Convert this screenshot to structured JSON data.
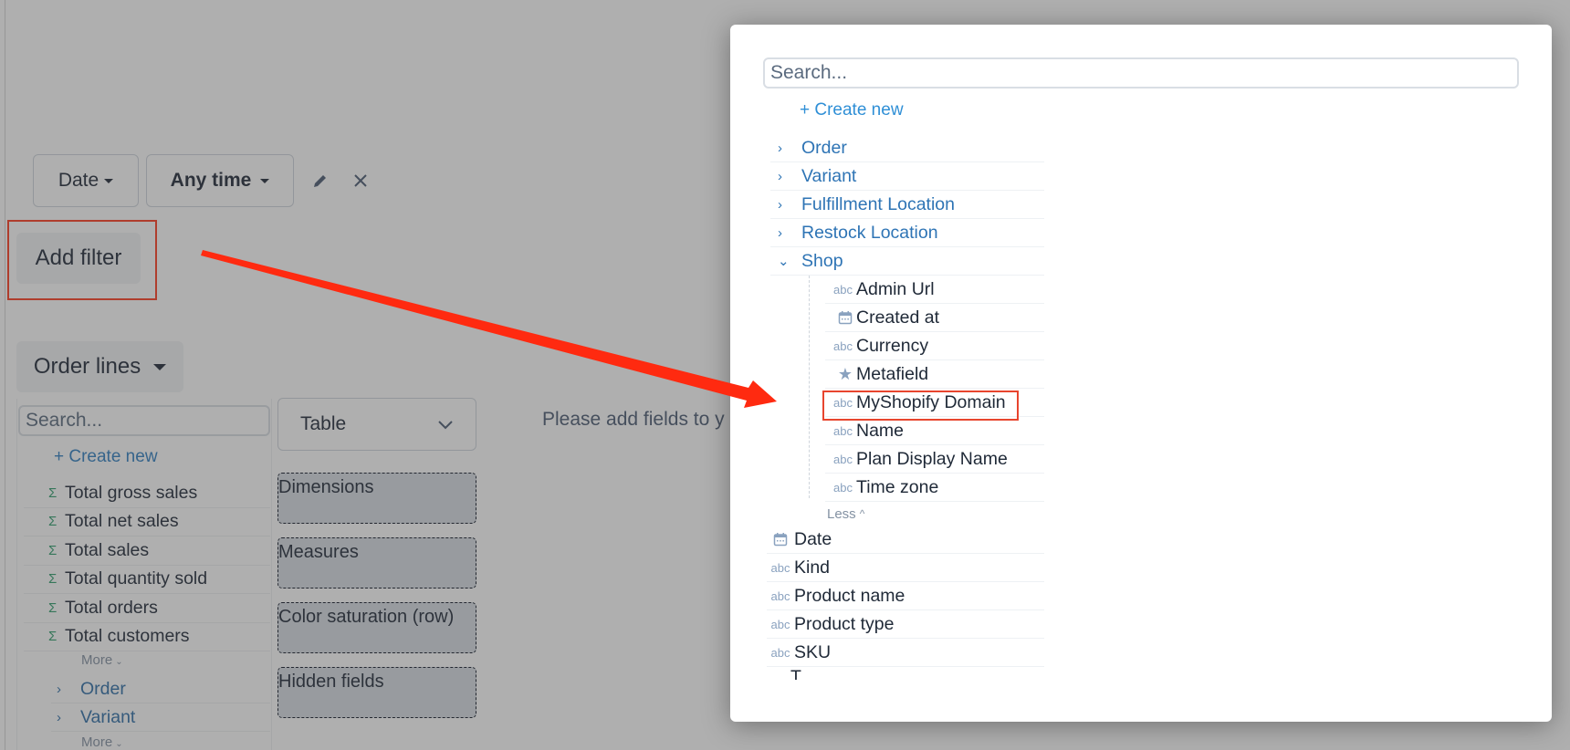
{
  "filters": {
    "field_label": "Date",
    "range_label": "Any time",
    "add_filter_label": "Add filter"
  },
  "source": {
    "label": "Order lines"
  },
  "field_panel": {
    "search_placeholder": "Search...",
    "create_new_label": "+ Create new",
    "measures": [
      {
        "label": "Total gross sales",
        "icon": "sigma-icon"
      },
      {
        "label": "Total net sales",
        "icon": "sigma-icon"
      },
      {
        "label": "Total sales",
        "icon": "sigma-icon"
      },
      {
        "label": "Total quantity sold",
        "icon": "sigma-icon"
      },
      {
        "label": "Total orders",
        "icon": "sigma-icon"
      },
      {
        "label": "Total customers",
        "icon": "sigma-icon"
      }
    ],
    "more_label": "More",
    "groups": [
      {
        "label": "Order"
      },
      {
        "label": "Variant"
      }
    ],
    "more_label_2": "More"
  },
  "viz": {
    "type_label": "Table",
    "drop_zones": [
      "Dimensions",
      "Measures",
      "Color saturation (row)",
      "Hidden fields"
    ],
    "empty_hint": "Please add fields to y"
  },
  "modal": {
    "search_placeholder": "Search...",
    "create_new_label": "+ Create new",
    "groups": [
      {
        "label": "Order",
        "expanded": false
      },
      {
        "label": "Variant",
        "expanded": false
      },
      {
        "label": "Fulfillment Location",
        "expanded": false
      },
      {
        "label": "Restock Location",
        "expanded": false
      },
      {
        "label": "Shop",
        "expanded": true
      }
    ],
    "shop_fields": [
      {
        "label": "Admin Url",
        "type": "abc"
      },
      {
        "label": "Created at",
        "type": "date"
      },
      {
        "label": "Currency",
        "type": "abc"
      },
      {
        "label": "Metafield",
        "type": "star"
      },
      {
        "label": "MyShopify Domain",
        "type": "abc",
        "highlighted": true
      },
      {
        "label": "Name",
        "type": "abc"
      },
      {
        "label": "Plan Display Name",
        "type": "abc"
      },
      {
        "label": "Time zone",
        "type": "abc"
      }
    ],
    "less_label": "Less",
    "top_fields": [
      {
        "label": "Date",
        "type": "date"
      },
      {
        "label": "Kind",
        "type": "abc"
      },
      {
        "label": "Product name",
        "type": "abc"
      },
      {
        "label": "Product type",
        "type": "abc"
      },
      {
        "label": "SKU",
        "type": "abc"
      },
      {
        "label": "T",
        "type": "abc"
      }
    ],
    "type_text": "abc"
  },
  "annotation": {
    "color": "#ff3b1f"
  }
}
